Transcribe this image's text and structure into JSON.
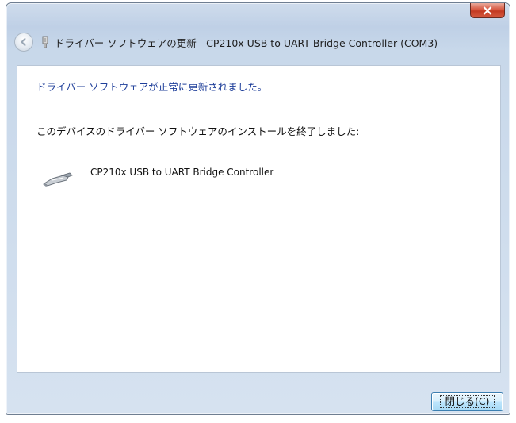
{
  "window": {
    "title": "ドライバー ソフトウェアの更新 - CP210x USB to UART Bridge Controller (COM3)",
    "close_glyph": "x"
  },
  "content": {
    "success_heading": "ドライバー ソフトウェアが正常に更新されました。",
    "finished_text": "このデバイスのドライバー ソフトウェアのインストールを終了しました:",
    "device_name": "CP210x USB to UART Bridge Controller"
  },
  "footer": {
    "close_button_label": "閉じる(C)"
  },
  "icons": {
    "back": "back-arrow-icon",
    "wizard": "device-wizard-icon",
    "device": "usb-connector-icon",
    "close": "close-icon"
  },
  "colors": {
    "heading_blue": "#1f3f9a",
    "close_red": "#c23a22",
    "button_blue": "#bee6fd"
  }
}
